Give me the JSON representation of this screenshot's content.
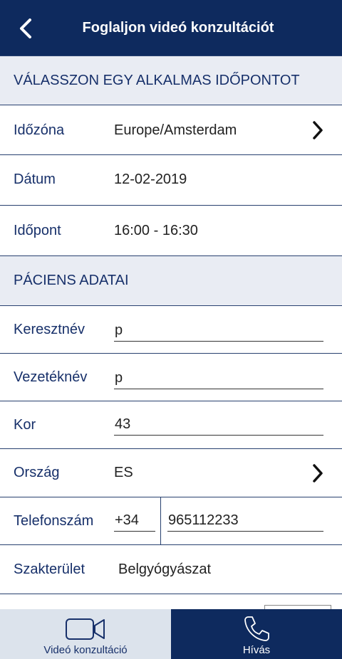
{
  "header": {
    "title": "Foglaljon videó konzultációt"
  },
  "section_time": {
    "title": "VÁLASSZON EGY ALKALMAS IDŐPONTOT"
  },
  "timezone": {
    "label": "Időzóna",
    "value": "Europe/Amsterdam"
  },
  "date": {
    "label": "Dátum",
    "value": "12-02-2019"
  },
  "time": {
    "label": "Időpont",
    "value": "16:00 - 16:30"
  },
  "section_patient": {
    "title": "PÁCIENS ADATAI"
  },
  "first_name": {
    "label": "Keresztnév",
    "value": "p"
  },
  "last_name": {
    "label": "Vezetéknév",
    "value": "p"
  },
  "age": {
    "label": "Kor",
    "value": "43"
  },
  "country": {
    "label": "Ország",
    "value": "ES"
  },
  "phone": {
    "label": "Telefonszám",
    "prefix": "+34",
    "number": "965112233"
  },
  "specialty": {
    "label": "Szakterület",
    "value": "Belgyógyászat"
  },
  "tabs": {
    "video": "Videó konzultáció",
    "call": "Hívás"
  },
  "colors": {
    "navy": "#0e2a5e",
    "label_blue": "#17306a",
    "section_bg": "#e9ecf3",
    "tab_inactive_bg": "#dce3ec"
  },
  "icons": {
    "back": "chevron-left-icon",
    "next": "chevron-right-icon",
    "video": "video-camera-icon",
    "call": "phone-icon"
  }
}
